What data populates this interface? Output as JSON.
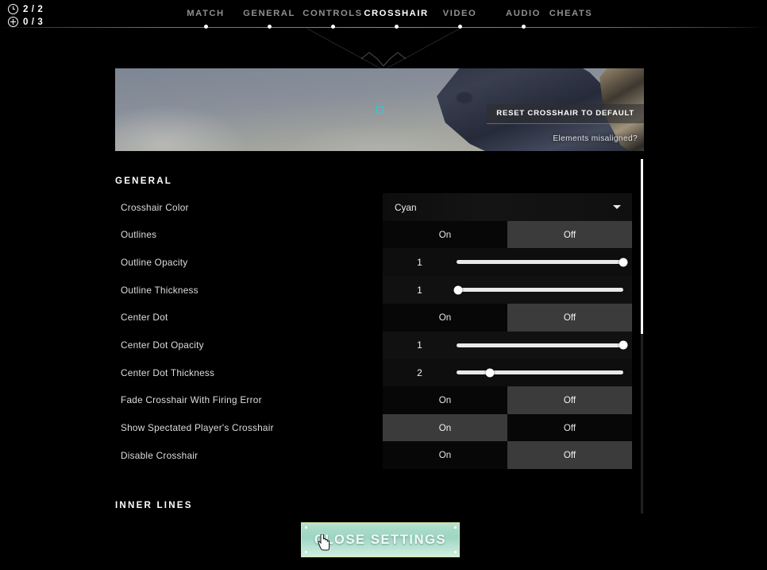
{
  "hud": {
    "rows": [
      {
        "icon": "clock-icon",
        "value": "2 / 2"
      },
      {
        "icon": "target-icon",
        "value": "0 / 3"
      }
    ]
  },
  "nav": {
    "tabs": [
      {
        "label": "MATCH",
        "active": false
      },
      {
        "label": "GENERAL",
        "active": false
      },
      {
        "label": "CONTROLS",
        "active": false
      },
      {
        "label": "CROSSHAIR",
        "active": true
      },
      {
        "label": "VIDEO",
        "active": false
      },
      {
        "label": "AUDIO",
        "active": false
      },
      {
        "label": "CHEATS",
        "active": false
      }
    ]
  },
  "preview": {
    "reset_button": "RESET CROSSHAIR TO DEFAULT",
    "misaligned_link": "Elements misaligned?",
    "crosshair_color_hex": "#19d6e2"
  },
  "settings": {
    "section_general": "GENERAL",
    "section_inner_lines": "INNER LINES",
    "rows": [
      {
        "label": "Crosshair Color",
        "type": "dropdown",
        "value": "Cyan"
      },
      {
        "label": "Outlines",
        "type": "toggle",
        "on_label": "On",
        "off_label": "Off",
        "selected": "Off"
      },
      {
        "label": "Outline Opacity",
        "type": "slider",
        "value": "1",
        "percent": 100
      },
      {
        "label": "Outline Thickness",
        "type": "slider",
        "value": "1",
        "percent": 1
      },
      {
        "label": "Center Dot",
        "type": "toggle",
        "on_label": "On",
        "off_label": "Off",
        "selected": "Off"
      },
      {
        "label": "Center Dot Opacity",
        "type": "slider",
        "value": "1",
        "percent": 100
      },
      {
        "label": "Center Dot Thickness",
        "type": "slider",
        "value": "2",
        "percent": 20
      },
      {
        "label": "Fade Crosshair With Firing Error",
        "type": "toggle",
        "on_label": "On",
        "off_label": "Off",
        "selected": "Off"
      },
      {
        "label": "Show Spectated Player's Crosshair",
        "type": "toggle",
        "on_label": "On",
        "off_label": "Off",
        "selected": "On"
      },
      {
        "label": "Disable Crosshair",
        "type": "toggle",
        "on_label": "On",
        "off_label": "Off",
        "selected": "Off"
      }
    ]
  },
  "footer": {
    "close_label": "CLOSE SETTINGS",
    "accent_hex": "#a8dbc8"
  }
}
